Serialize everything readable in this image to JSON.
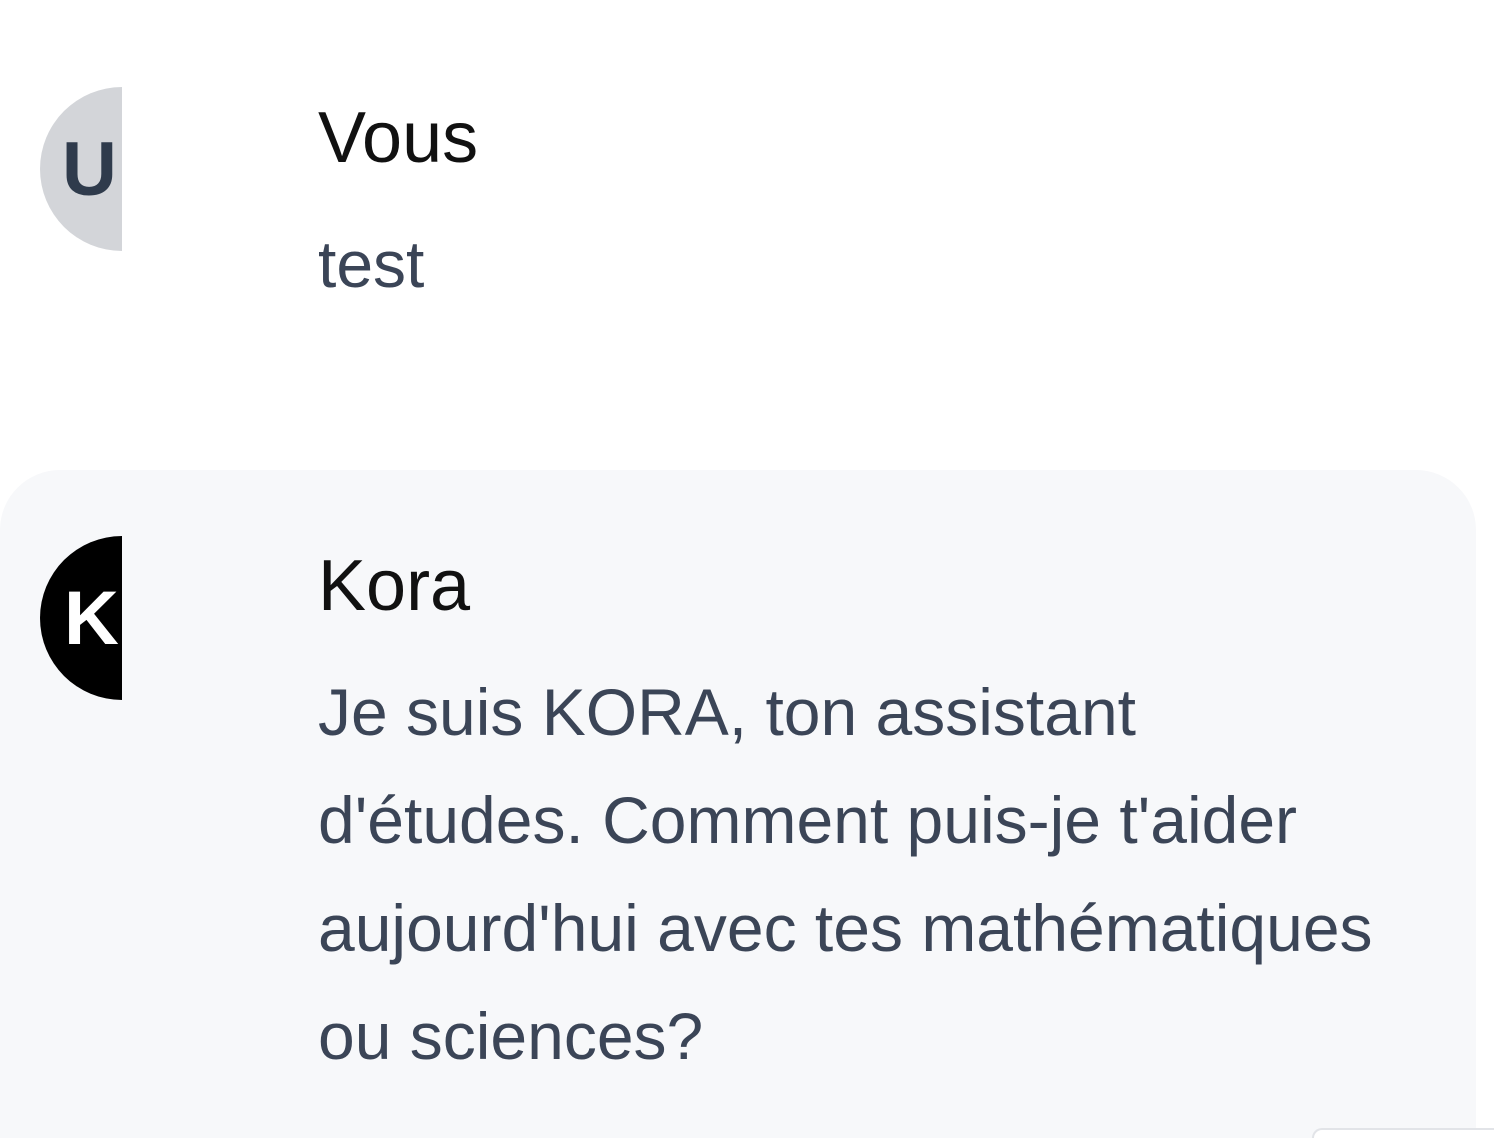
{
  "messages": [
    {
      "role": "user",
      "avatar_letter": "U",
      "sender": "Vous",
      "text": "test"
    },
    {
      "role": "assistant",
      "avatar_letter": "K",
      "sender": "Kora",
      "text": "Je suis KORA, ton assistant d'études. Comment puis-je t'aider aujourd'hui avec tes mathématiques ou sciences?"
    }
  ],
  "colors": {
    "user_avatar_bg": "#d3d5d9",
    "assistant_avatar_bg": "#000000",
    "assistant_message_bg": "#f7f8fa",
    "sender_text": "#111111",
    "body_text": "#3b4557"
  }
}
